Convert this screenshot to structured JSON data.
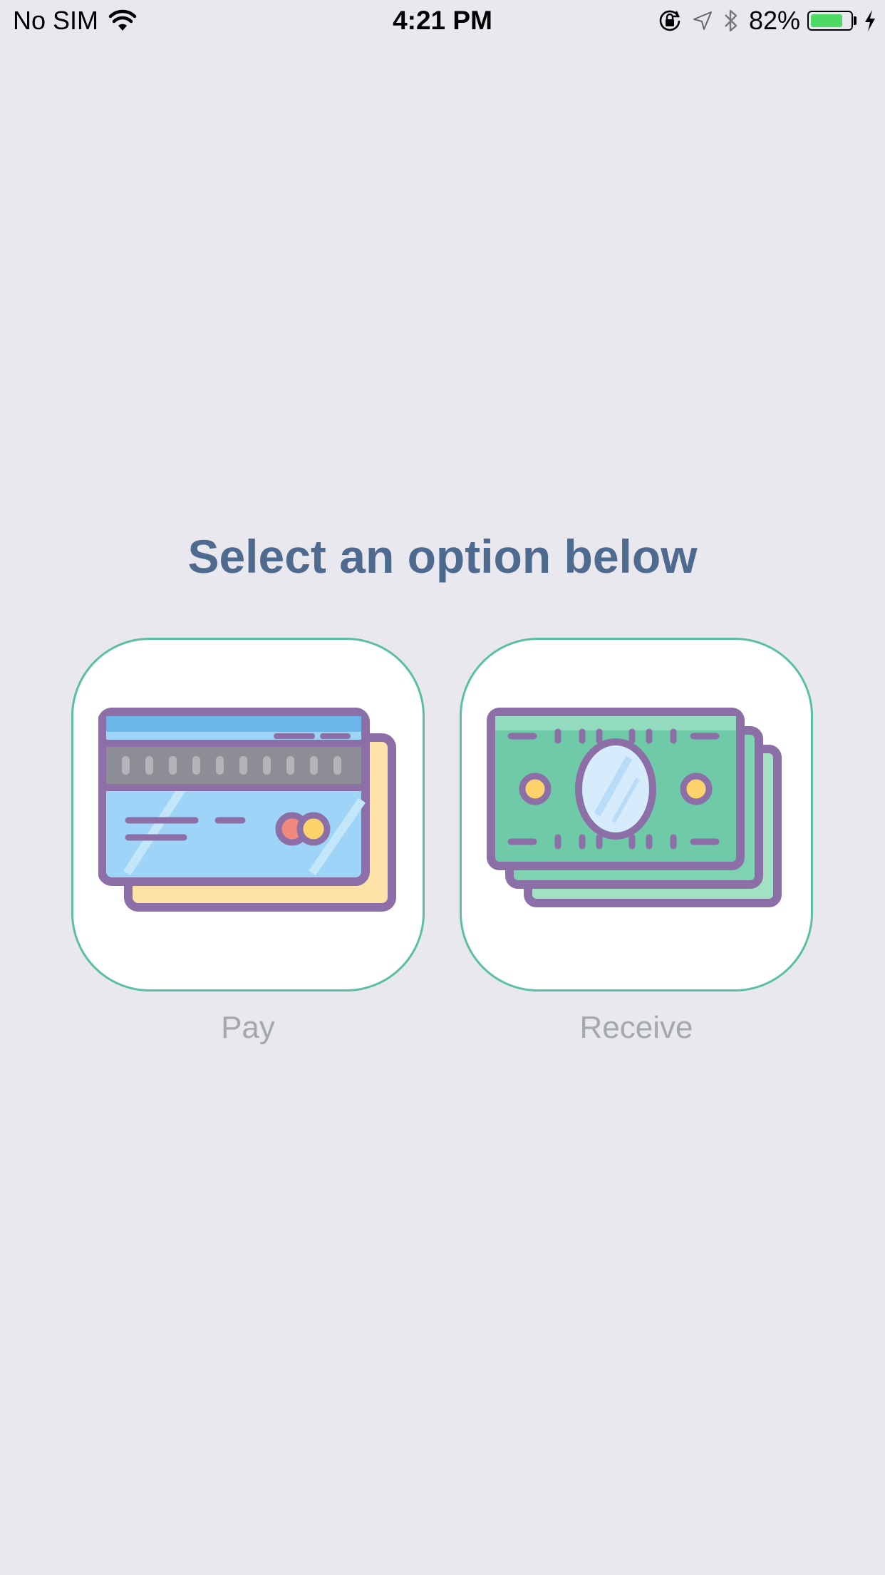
{
  "status_bar": {
    "carrier": "No SIM",
    "time": "4:21 PM",
    "battery_percent": "82%",
    "battery_level": 0.82,
    "battery_color": "#4cd964",
    "icons": [
      "wifi-icon",
      "orientation-lock-icon",
      "location-icon",
      "bluetooth-icon",
      "battery-icon",
      "charging-icon"
    ]
  },
  "main": {
    "prompt": "Select an option below",
    "options": [
      {
        "label": "Pay",
        "icon": "credit-card-icon"
      },
      {
        "label": "Receive",
        "icon": "cash-stack-icon"
      }
    ]
  },
  "colors": {
    "background": "#e9e8ef",
    "prompt_text": "#4e6a8f",
    "card_border": "#5bbfa1",
    "label_text": "#a3a8ad",
    "icon_outline": "#8d6fa8"
  }
}
